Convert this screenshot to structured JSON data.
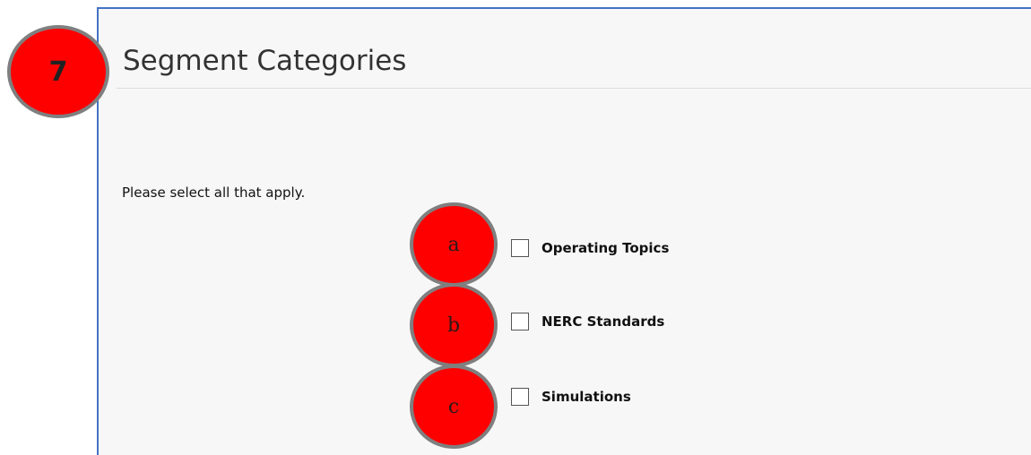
{
  "section": {
    "title": "Segment Categories",
    "instruction": "Please select all that apply."
  },
  "step_marker": {
    "label": "7"
  },
  "options": [
    {
      "marker": "a",
      "label": "Operating Topics",
      "checked": false
    },
    {
      "marker": "b",
      "label": "NERC Standards",
      "checked": false
    },
    {
      "marker": "c",
      "label": "Simulations",
      "checked": false
    }
  ],
  "colors": {
    "marker_fill": "#ff0000",
    "marker_border": "#7f7f7f",
    "panel_border": "#4472c4",
    "panel_background": "#f7f7f7"
  }
}
